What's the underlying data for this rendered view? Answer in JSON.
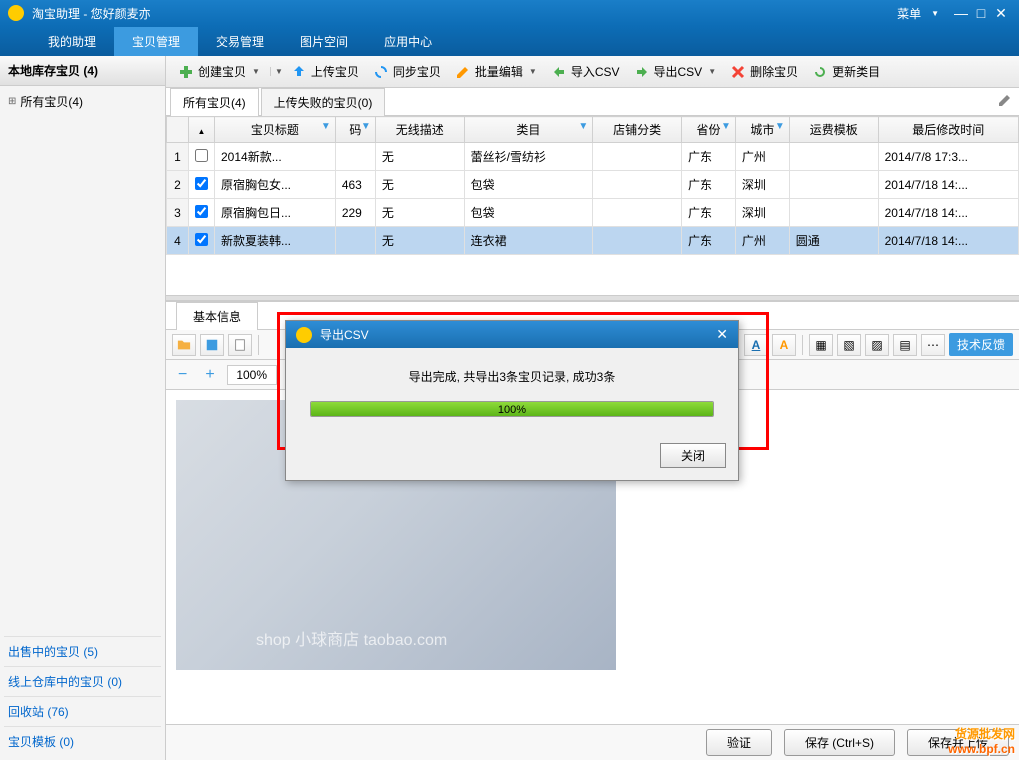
{
  "titlebar": {
    "title": "淘宝助理 - 您好颜麦亦",
    "menu": "菜单"
  },
  "maintabs": {
    "items": [
      "我的助理",
      "宝贝管理",
      "交易管理",
      "图片空间",
      "应用中心"
    ],
    "selected": 1
  },
  "toolbar": {
    "create": "创建宝贝",
    "upload": "上传宝贝",
    "sync": "同步宝贝",
    "batch": "批量编辑",
    "importcsv": "导入CSV",
    "exportcsv": "导出CSV",
    "delete": "删除宝贝",
    "refresh": "更新类目"
  },
  "sidebar": {
    "head": "本地库存宝贝 (4)",
    "tree_item": "所有宝贝(4)",
    "links": {
      "selling": "出售中的宝贝 (5)",
      "online_stock": "线上仓库中的宝贝 (0)",
      "recycle": "回收站 (76)",
      "templates": "宝贝模板 (0)"
    }
  },
  "subtabs": {
    "all": "所有宝贝(4)",
    "failed": "上传失败的宝贝(0)"
  },
  "table": {
    "cols": [
      "宝贝标题",
      "码",
      "无线描述",
      "类目",
      "店铺分类",
      "省份",
      "城市",
      "运费模板",
      "最后修改时间"
    ],
    "rows": [
      {
        "checked": false,
        "title": "2014新款...",
        "code": "",
        "wifi": "无",
        "cat": "蕾丝衫/雪纺衫",
        "shopcat": "",
        "prov": "广东",
        "city": "广州",
        "ship": "",
        "time": "2014/7/8 17:3..."
      },
      {
        "checked": true,
        "title": "原宿胸包女...",
        "code": "463",
        "wifi": "无",
        "cat": "包袋",
        "shopcat": "",
        "prov": "广东",
        "city": "深圳",
        "ship": "",
        "time": "2014/7/18 14:..."
      },
      {
        "checked": true,
        "title": "原宿胸包日...",
        "code": "229",
        "wifi": "无",
        "cat": "包袋",
        "shopcat": "",
        "prov": "广东",
        "city": "深圳",
        "ship": "",
        "time": "2014/7/18 14:..."
      },
      {
        "checked": true,
        "title": "新款夏装韩...",
        "code": "",
        "wifi": "无",
        "cat": "连衣裙",
        "shopcat": "",
        "prov": "广东",
        "city": "广州",
        "ship": "圆通",
        "time": "2014/7/18 14:..."
      }
    ],
    "selected": 3
  },
  "detail": {
    "tab": "基本信息",
    "zoom": "100%",
    "feedback": "技术反馈",
    "watermark": "shop 小球商店 taobao.com"
  },
  "bottom": {
    "verify": "验证",
    "save": "保存 (Ctrl+S)",
    "save_upload": "保存并上传"
  },
  "dialog": {
    "title": "导出CSV",
    "message": "导出完成, 共导出3条宝贝记录, 成功3条",
    "progress": 100,
    "progress_label": "100%",
    "close": "关闭"
  },
  "watermark": {
    "line1": "货源批发网",
    "line2": "www.bpf.cn"
  }
}
